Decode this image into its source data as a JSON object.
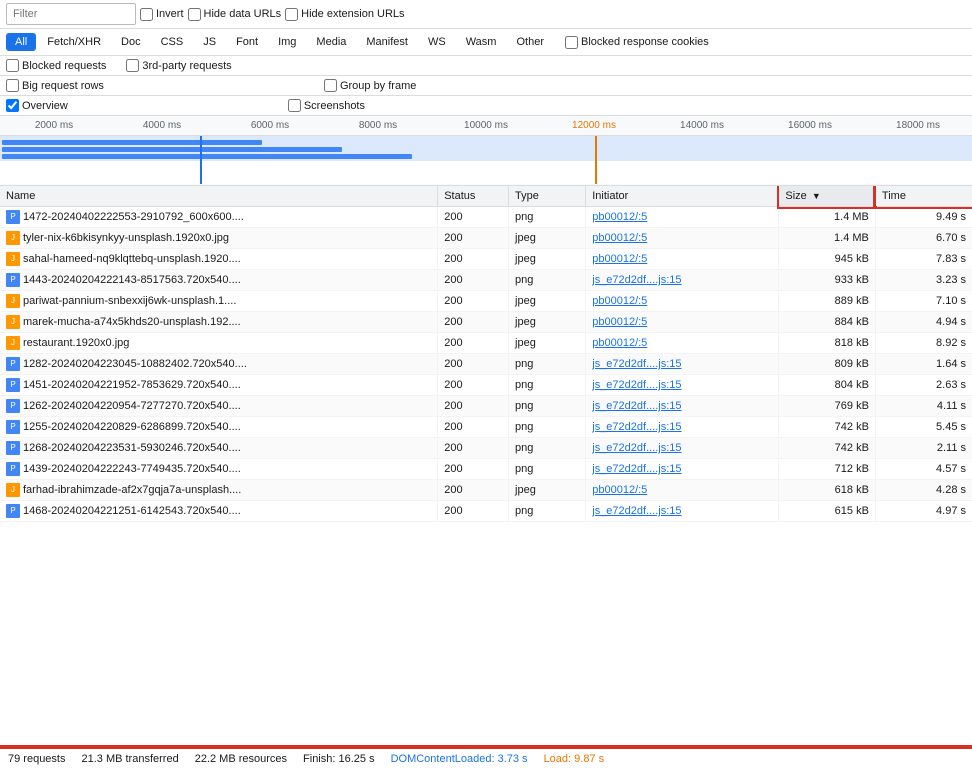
{
  "toolbar": {
    "filter_placeholder": "Filter",
    "invert_label": "Invert",
    "hide_data_urls_label": "Hide data URLs",
    "hide_extension_urls_label": "Hide extension URLs"
  },
  "filter_buttons": [
    {
      "id": "all",
      "label": "All",
      "active": true
    },
    {
      "id": "fetch-xhr",
      "label": "Fetch/XHR",
      "active": false
    },
    {
      "id": "doc",
      "label": "Doc",
      "active": false
    },
    {
      "id": "css",
      "label": "CSS",
      "active": false
    },
    {
      "id": "js",
      "label": "JS",
      "active": false
    },
    {
      "id": "font",
      "label": "Font",
      "active": false
    },
    {
      "id": "img",
      "label": "Img",
      "active": false
    },
    {
      "id": "media",
      "label": "Media",
      "active": false
    },
    {
      "id": "manifest",
      "label": "Manifest",
      "active": false
    },
    {
      "id": "ws",
      "label": "WS",
      "active": false
    },
    {
      "id": "wasm",
      "label": "Wasm",
      "active": false
    },
    {
      "id": "other",
      "label": "Other",
      "active": false
    }
  ],
  "options": {
    "blocked_response_cookies": "Blocked response cookies",
    "blocked_requests": "Blocked requests",
    "third_party_requests": "3rd-party requests",
    "big_request_rows": "Big request rows",
    "group_by_frame": "Group by frame",
    "overview_checked": true,
    "overview_label": "Overview",
    "screenshots_label": "Screenshots"
  },
  "timeline": {
    "ticks": [
      "2000 ms",
      "4000 ms",
      "6000 ms",
      "8000 ms",
      "10000 ms",
      "12000 ms",
      "14000 ms",
      "16000 ms",
      "18000 ms"
    ]
  },
  "table": {
    "headers": [
      {
        "id": "name",
        "label": "Name"
      },
      {
        "id": "status",
        "label": "Status"
      },
      {
        "id": "type",
        "label": "Type"
      },
      {
        "id": "initiator",
        "label": "Initiator"
      },
      {
        "id": "size",
        "label": "Size",
        "sort": "desc"
      },
      {
        "id": "time",
        "label": "Time"
      }
    ],
    "rows": [
      {
        "name": "1472-20240402222553-2910792_600x600....",
        "status": "200",
        "type": "png",
        "initiator": "pb00012/:5",
        "size": "1.4 MB",
        "time": "9.49 s"
      },
      {
        "name": "tyler-nix-k6bkisynkyy-unsplash.1920x0.jpg",
        "status": "200",
        "type": "jpeg",
        "initiator": "pb00012/:5",
        "size": "1.4 MB",
        "time": "6.70 s"
      },
      {
        "name": "sahal-hameed-nq9klqttebq-unsplash.1920....",
        "status": "200",
        "type": "jpeg",
        "initiator": "pb00012/:5",
        "size": "945 kB",
        "time": "7.83 s"
      },
      {
        "name": "1443-20240204222143-8517563.720x540....",
        "status": "200",
        "type": "png",
        "initiator": "js_e72d2df....js:15",
        "size": "933 kB",
        "time": "3.23 s"
      },
      {
        "name": "pariwat-pannium-snbexxij6wk-unsplash.1....",
        "status": "200",
        "type": "jpeg",
        "initiator": "pb00012/:5",
        "size": "889 kB",
        "time": "7.10 s"
      },
      {
        "name": "marek-mucha-a74x5khds20-unsplash.192....",
        "status": "200",
        "type": "jpeg",
        "initiator": "pb00012/:5",
        "size": "884 kB",
        "time": "4.94 s"
      },
      {
        "name": "restaurant.1920x0.jpg",
        "status": "200",
        "type": "jpeg",
        "initiator": "pb00012/:5",
        "size": "818 kB",
        "time": "8.92 s"
      },
      {
        "name": "1282-20240204223045-10882402.720x540....",
        "status": "200",
        "type": "png",
        "initiator": "js_e72d2df....js:15",
        "size": "809 kB",
        "time": "1.64 s"
      },
      {
        "name": "1451-20240204221952-7853629.720x540....",
        "status": "200",
        "type": "png",
        "initiator": "js_e72d2df....js:15",
        "size": "804 kB",
        "time": "2.63 s"
      },
      {
        "name": "1262-20240204220954-7277270.720x540....",
        "status": "200",
        "type": "png",
        "initiator": "js_e72d2df....js:15",
        "size": "769 kB",
        "time": "4.11 s"
      },
      {
        "name": "1255-20240204220829-6286899.720x540....",
        "status": "200",
        "type": "png",
        "initiator": "js_e72d2df....js:15",
        "size": "742 kB",
        "time": "5.45 s"
      },
      {
        "name": "1268-20240204223531-5930246.720x540....",
        "status": "200",
        "type": "png",
        "initiator": "js_e72d2df....js:15",
        "size": "742 kB",
        "time": "2.11 s"
      },
      {
        "name": "1439-20240204222243-7749435.720x540....",
        "status": "200",
        "type": "png",
        "initiator": "js_e72d2df....js:15",
        "size": "712 kB",
        "time": "4.57 s"
      },
      {
        "name": "farhad-ibrahimzade-af2x7gqja7a-unsplash....",
        "status": "200",
        "type": "jpeg",
        "initiator": "pb00012/:5",
        "size": "618 kB",
        "time": "4.28 s"
      },
      {
        "name": "1468-20240204221251-6142543.720x540....",
        "status": "200",
        "type": "png",
        "initiator": "js_e72d2df....js:15",
        "size": "615 kB",
        "time": "4.97 s"
      }
    ]
  },
  "status_bar": {
    "requests": "79 requests",
    "transferred": "21.3 MB transferred",
    "resources": "22.2 MB resources",
    "finish": "Finish: 16.25 s",
    "dom_content_loaded": "DOMContentLoaded: 3.73 s",
    "load": "Load: 9.87 s"
  }
}
